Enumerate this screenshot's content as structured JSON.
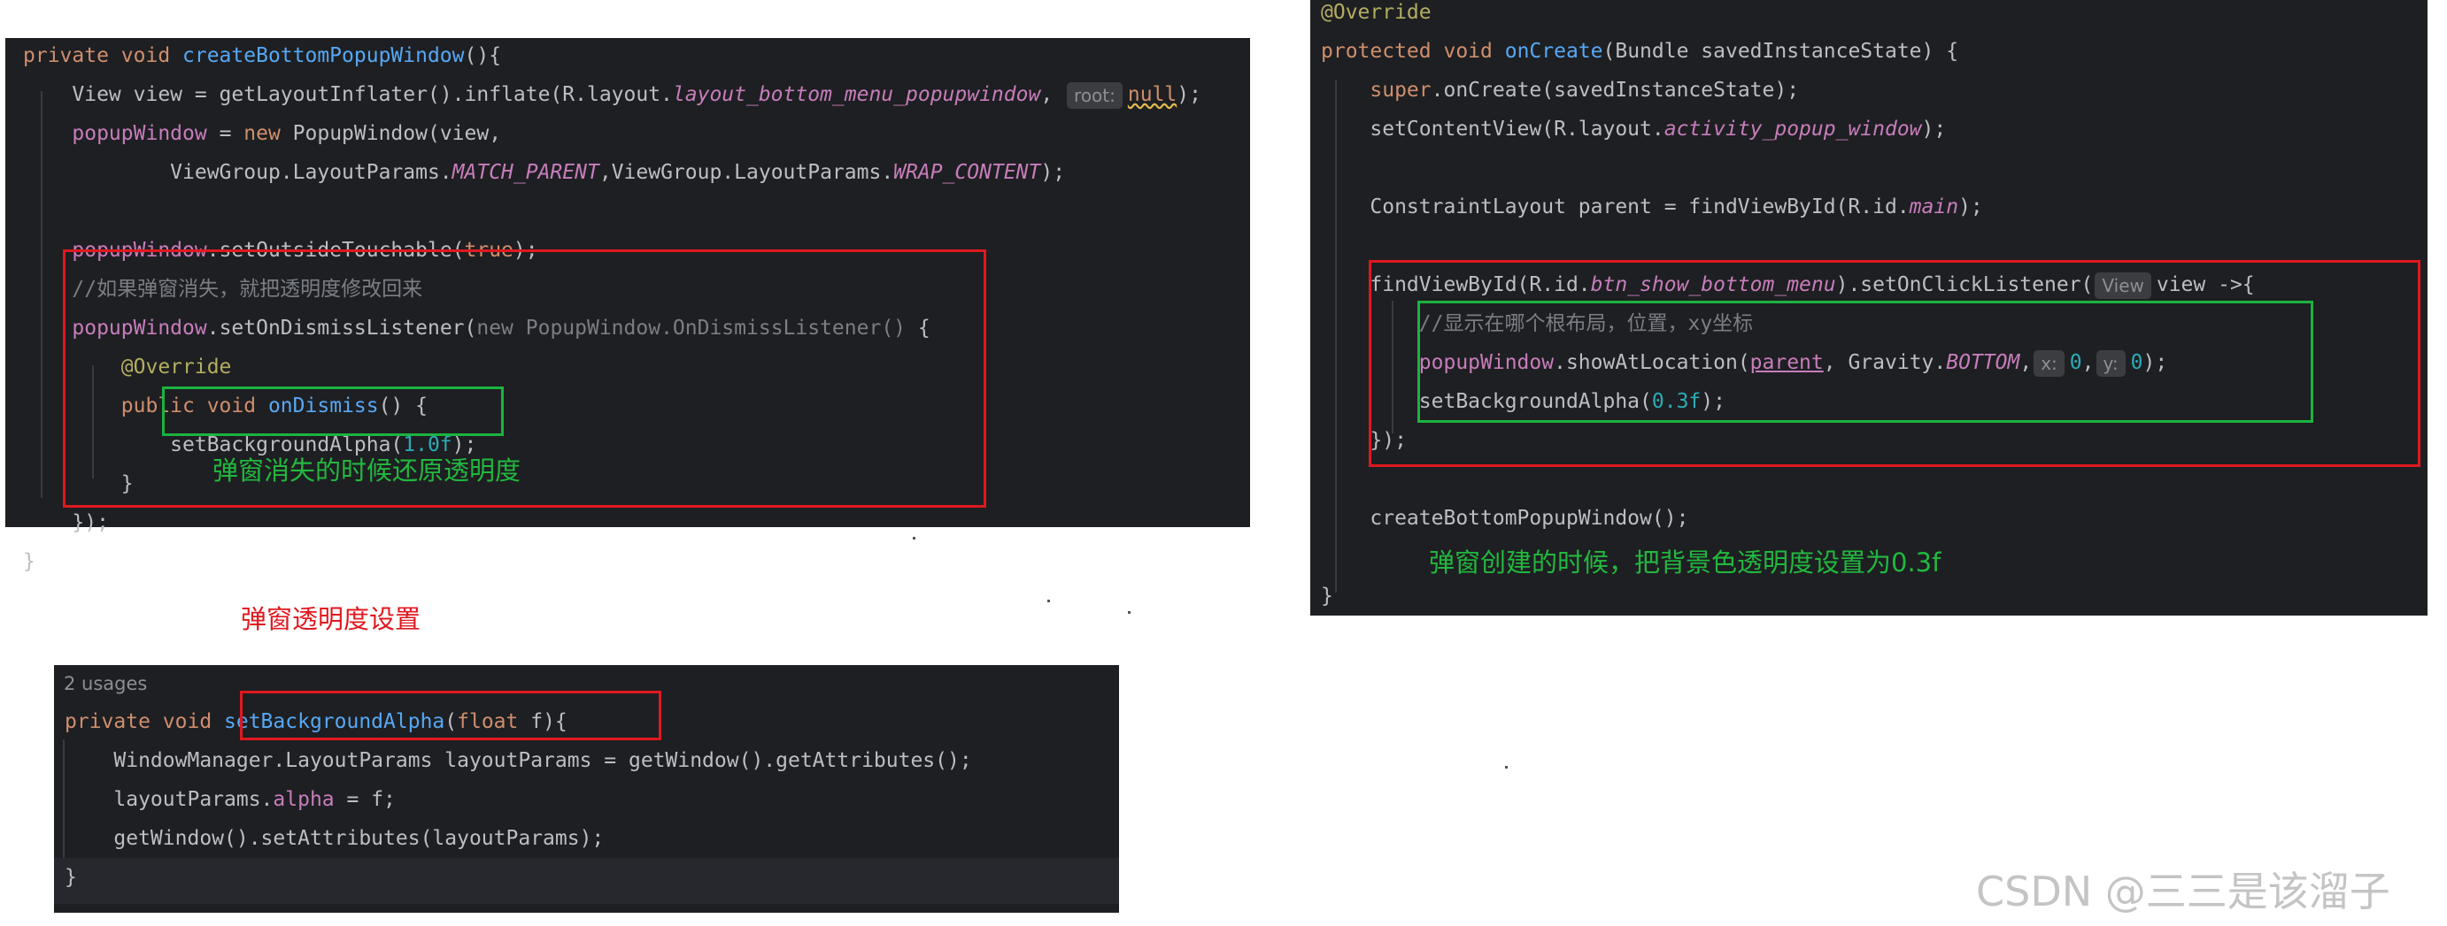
{
  "panel1": {
    "lines": [
      [
        {
          "t": "private void ",
          "c": "kw"
        },
        {
          "t": "createBottomPopupWindow",
          "c": "fn"
        },
        {
          "t": "(){"
        }
      ],
      [
        {
          "t": "    View view = getLayoutInflater().inflate(R.layout."
        },
        {
          "t": "layout_bottom_menu_popupwindow",
          "c": "ital"
        },
        {
          "t": ", "
        },
        {
          "t": "root:",
          "c": "hint"
        },
        {
          "t": "null",
          "c": "kw wavy"
        },
        {
          "t": ");"
        }
      ],
      [
        {
          "t": "    "
        },
        {
          "t": "popupWindow",
          "c": "pf"
        },
        {
          "t": " = "
        },
        {
          "t": "new ",
          "c": "kw"
        },
        {
          "t": "PopupWindow(view,"
        }
      ],
      [
        {
          "t": "            ViewGroup.LayoutParams."
        },
        {
          "t": "MATCH_PARENT",
          "c": "ital"
        },
        {
          "t": ",ViewGroup.LayoutParams."
        },
        {
          "t": "WRAP_CONTENT",
          "c": "ital"
        },
        {
          "t": ");"
        }
      ],
      [
        {
          "t": ""
        }
      ],
      [
        {
          "t": "    "
        },
        {
          "t": "popupWindow",
          "c": "pf"
        },
        {
          "t": ".setOutsideTouchable("
        },
        {
          "t": "true",
          "c": "kw"
        },
        {
          "t": ");"
        }
      ],
      [
        {
          "t": "    "
        },
        {
          "t": "//如果弹窗消失，就把透明度修改回来",
          "c": "cm"
        }
      ],
      [
        {
          "t": "    "
        },
        {
          "t": "popupWindow",
          "c": "pf"
        },
        {
          "t": ".setOnDismissListener("
        },
        {
          "t": "new PopupWindow.OnDismissListener() ",
          "c": "gray"
        },
        {
          "t": "{"
        }
      ],
      [
        {
          "t": "        "
        },
        {
          "t": "@Override",
          "c": "ann"
        }
      ],
      [
        {
          "t": "        "
        },
        {
          "t": "public void ",
          "c": "kw"
        },
        {
          "t": "onDismiss",
          "c": "fn"
        },
        {
          "t": "() {"
        }
      ],
      [
        {
          "t": "            setBackgroundAlpha("
        },
        {
          "t": "1.0f",
          "c": "num"
        },
        {
          "t": ");"
        }
      ],
      [
        {
          "t": "        }"
        }
      ],
      [
        {
          "t": "    });"
        }
      ],
      [
        {
          "t": "}"
        }
      ]
    ],
    "note": "弹窗消失的时候还原透明度"
  },
  "panel2": {
    "usages": "2 usages",
    "lines": [
      [
        {
          "t": "private void ",
          "c": "kw"
        },
        {
          "t": "setBackgroundAlpha",
          "c": "fn"
        },
        {
          "t": "("
        },
        {
          "t": "float ",
          "c": "kw"
        },
        {
          "t": "f){"
        }
      ],
      [
        {
          "t": "    WindowManager.LayoutParams layoutParams = getWindow().getAttributes();"
        }
      ],
      [
        {
          "t": "    layoutParams."
        },
        {
          "t": "alpha",
          "c": "pf"
        },
        {
          "t": " = f;"
        }
      ],
      [
        {
          "t": "    getWindow().setAttributes(layoutParams);"
        }
      ],
      [
        {
          "t": "}"
        }
      ]
    ],
    "title": "弹窗透明度设置"
  },
  "panel3": {
    "lines": [
      [
        {
          "t": "@Override",
          "c": "ann"
        }
      ],
      [
        {
          "t": "protected void ",
          "c": "kw"
        },
        {
          "t": "onCreate",
          "c": "fn"
        },
        {
          "t": "(Bundle savedInstanceState) {"
        }
      ],
      [
        {
          "t": "    "
        },
        {
          "t": "super",
          "c": "kw"
        },
        {
          "t": ".onCreate(savedInstanceState);"
        }
      ],
      [
        {
          "t": "    setContentView(R.layout."
        },
        {
          "t": "activity_popup_window",
          "c": "ital"
        },
        {
          "t": ");"
        }
      ],
      [
        {
          "t": ""
        }
      ],
      [
        {
          "t": "    ConstraintLayout parent = findViewById(R.id."
        },
        {
          "t": "main",
          "c": "ital"
        },
        {
          "t": ");"
        }
      ],
      [
        {
          "t": ""
        }
      ],
      [
        {
          "t": "    findViewById(R.id."
        },
        {
          "t": "btn_show_bottom_menu",
          "c": "ital"
        },
        {
          "t": ").setOnClickListener("
        },
        {
          "t": "View",
          "c": "hint"
        },
        {
          "t": "view ->{"
        }
      ],
      [
        {
          "t": "        "
        },
        {
          "t": "//显示在哪个根布局，位置，xy坐标",
          "c": "cm"
        }
      ],
      [
        {
          "t": "        "
        },
        {
          "t": "popupWindow",
          "c": "pf"
        },
        {
          "t": ".showAtLocation("
        },
        {
          "t": "parent",
          "c": "pf ul"
        },
        {
          "t": ", Gravity."
        },
        {
          "t": "BOTTOM",
          "c": "ital"
        },
        {
          "t": ","
        },
        {
          "t": "x:",
          "c": "hint"
        },
        {
          "t": "0",
          "c": "num"
        },
        {
          "t": ","
        },
        {
          "t": "y:",
          "c": "hint"
        },
        {
          "t": "0",
          "c": "num"
        },
        {
          "t": ");"
        }
      ],
      [
        {
          "t": "        setBackgroundAlpha("
        },
        {
          "t": "0.3f",
          "c": "num"
        },
        {
          "t": ");"
        }
      ],
      [
        {
          "t": "    });"
        }
      ],
      [
        {
          "t": ""
        }
      ],
      [
        {
          "t": "    createBottomPopupWindow();"
        }
      ],
      [
        {
          "t": ""
        }
      ],
      [
        {
          "t": "}"
        }
      ]
    ],
    "note": "弹窗创建的时候，把背景色透明度设置为0.3f"
  },
  "watermark": "CSDN @三三是该溜子",
  "colors": {
    "editor_bg": "#1e1f22",
    "keyword": "#cf8e6d",
    "function": "#56a8f5",
    "field": "#c77dbb",
    "number": "#2aacb8",
    "annotation": "#b3ae60",
    "comment": "#7a7e85",
    "red_box": "#e0181f",
    "green_box": "#1bb33f"
  }
}
